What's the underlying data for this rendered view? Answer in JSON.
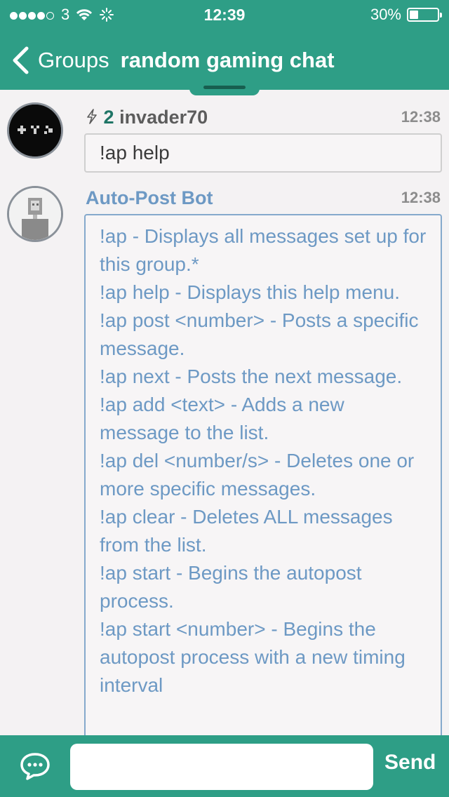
{
  "status_bar": {
    "carrier": "3",
    "time": "12:39",
    "battery": "30%",
    "battery_level": 0.3
  },
  "nav": {
    "back_label": "Groups",
    "title": "random gaming chat"
  },
  "messages": [
    {
      "karma": "2",
      "author": "invader70",
      "time": "12:38",
      "text": "!ap help",
      "avatar": "space-invaders-avatar"
    },
    {
      "author": "Auto-Post Bot",
      "time": "12:38",
      "avatar": "bot-avatar",
      "lines": [
        "!ap - Displays all messages set up for this group.*",
        "!ap help - Displays this help menu.",
        "!ap post <number> - Posts a specific message.",
        "!ap next - Posts the next message.",
        "!ap add <text> - Adds a new message to the list.",
        "!ap del <number/s> - Deletes one or more specific messages.",
        "!ap clear - Deletes ALL messages from the list.",
        "!ap start - Begins the autopost process.",
        "!ap start <number> - Begins the autopost process with a new timing interval"
      ]
    }
  ],
  "composer": {
    "input_value": "",
    "send_label": "Send"
  },
  "colors": {
    "accent": "#2e9e86",
    "bot_text": "#6d99c4",
    "bot_border": "#85a9cc"
  }
}
